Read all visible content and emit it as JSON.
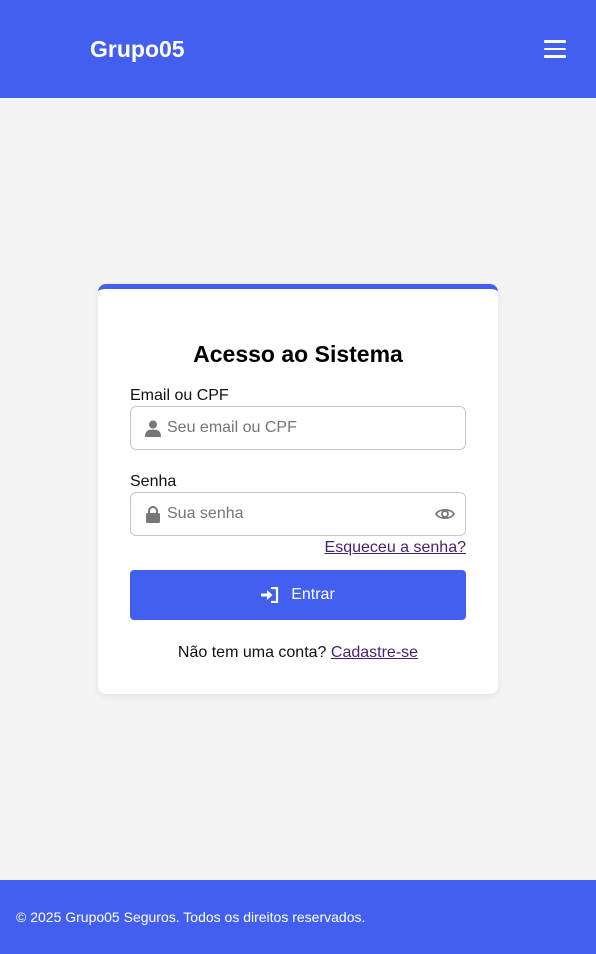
{
  "header": {
    "brand": "Grupo05",
    "menu_icon": "hamburger-menu-icon",
    "color": "#425ff0"
  },
  "login": {
    "title": "Acesso ao Sistema",
    "email_label": "Email ou CPF",
    "email_placeholder": "Seu email ou CPF",
    "email_icon": "user-icon",
    "password_label": "Senha",
    "password_placeholder": "Sua senha",
    "password_icon": "lock-icon",
    "toggle_icon": "eye-icon",
    "forgot_link": "Esqueceu a senha?",
    "submit_label": "Entrar",
    "submit_icon": "sign-in-icon",
    "signup_prompt": "Não tem uma conta?",
    "signup_link": "Cadastre-se"
  },
  "footer": {
    "text": "© 2025 Grupo05 Seguros. Todos os direitos reservados."
  },
  "colors": {
    "accent": "#425ff0",
    "link": "#4b1d6e",
    "background": "#f4f4f4"
  }
}
